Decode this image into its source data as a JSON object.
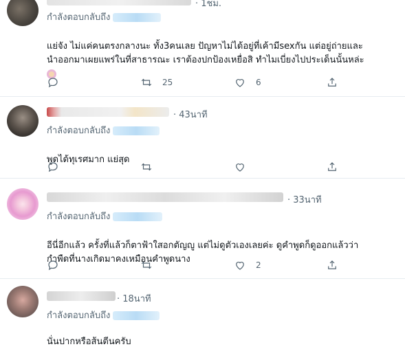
{
  "tweets": [
    {
      "time": "· 1ชม.",
      "reply_prefix": "กำลังตอบกลับถึง",
      "text": "แย่จัง ไม่แค่คนตรงกลางนะ ทั้ง3คนเลย ปัญหาไม่ได้อยู่ที่เค้ามีsexกัน แต่อยู่ถ่ายและ\nนำออกมาเผยแพร่ในที่สาธารณะ เราต้องปกป้องเหยื่อสิ ทำไมเบี่ยงไปประเด็นนั้นหล่ะ",
      "emoji": "woman-icon",
      "retweets": "25",
      "likes": "6"
    },
    {
      "time": "· 43นาที",
      "reply_prefix": "กำลังตอบกลับถึง",
      "text": "พูดได้ทุเรศมาก แย่สุด",
      "retweets": "",
      "likes": ""
    },
    {
      "time": "· 33นาที",
      "reply_prefix": "กำลังตอบกลับถึง",
      "text": "อีนี่อีกแล้ว ครั้งที่แล้วก็ตาฟ้าใสอกตัญญู แต่ไม่ดูตัวเองเลยค่ะ ดูคำพูดก็ดูออกแล้วว่า\nกำพืดที่นางเกิดมาคงเหมือนคำพูดนาง",
      "retweets": "",
      "likes": "2"
    },
    {
      "time": "· 18นาที",
      "reply_prefix": "กำลังตอบกลับถึง",
      "text": "นั่นปากหรือส้นตีนครับ"
    }
  ],
  "icons": {
    "reply": "reply-icon",
    "retweet": "retweet-icon",
    "like": "heart-icon",
    "share": "share-icon"
  },
  "colors": {
    "secondary_text": "#536471",
    "mention_blur": "#b9dcf5",
    "divider": "#e6ecf0"
  }
}
